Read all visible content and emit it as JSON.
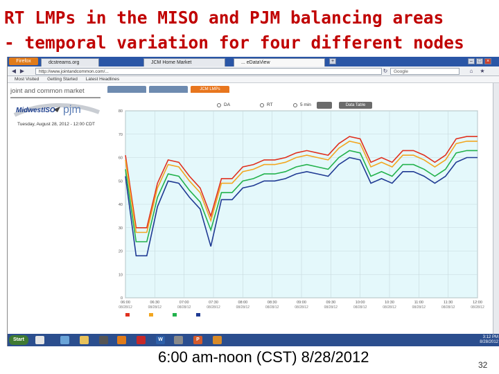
{
  "slide": {
    "title_line1": "RT LMPs in the MISO and PJM balancing areas",
    "title_line2": "- temporal variation for four different nodes",
    "caption": "6:00 am-noon (CST) 8/28/2012",
    "page_number": "32"
  },
  "browser": {
    "firefox_label": "Firefox",
    "tabs": [
      "dcstreams.org",
      "JCM Home Market",
      "... eDataView"
    ],
    "url": "http://www.jointandcommon.com/...",
    "search_placeholder": "Google",
    "bookmarks": [
      "Most Visited",
      "Getting Started",
      "Latest Headlines"
    ]
  },
  "site": {
    "header": "joint and common market",
    "miso_logo": "MidwestISO",
    "pjm_logo": "pjm",
    "date_line": "Tuesday, August 28, 2012 - 12:00 CDT",
    "tabs": [
      "",
      "",
      "JCM LMPs"
    ],
    "controls": [
      "DA",
      "RT",
      "5 min",
      "Data Table"
    ]
  },
  "taskbar": {
    "start_label": "Start",
    "clock_time": "3:12 PM",
    "clock_date": "8/28/2012"
  },
  "chart_data": {
    "type": "line",
    "x": [
      "06:00",
      "06:30",
      "07:00",
      "07:30",
      "08:00",
      "08:30",
      "09:00",
      "09:30",
      "10:00",
      "10:30",
      "11:00",
      "11:30",
      "12:00"
    ],
    "xdate": "08/28/12",
    "ylim": [
      0,
      80
    ],
    "yticks": [
      0,
      10,
      20,
      30,
      40,
      50,
      60,
      70,
      80
    ],
    "grid": true,
    "legend_placement": "bottom",
    "legend": [
      "",
      "",
      "",
      ""
    ],
    "series": [
      {
        "color": "#e0301e",
        "values": [
          61,
          30,
          30,
          49,
          59,
          58,
          52,
          47,
          35,
          51,
          51,
          56,
          57,
          59,
          59,
          60,
          62,
          63,
          62,
          61,
          66,
          69,
          68,
          58,
          60,
          58,
          63,
          63,
          61,
          58,
          61,
          68,
          69,
          69
        ]
      },
      {
        "color": "#f2a61f",
        "values": [
          59,
          28,
          28,
          47,
          57,
          56,
          50,
          45,
          33,
          49,
          49,
          54,
          55,
          57,
          57,
          58,
          60,
          61,
          60,
          59,
          64,
          67,
          66,
          56,
          58,
          56,
          61,
          61,
          59,
          56,
          59,
          66,
          67,
          67
        ]
      },
      {
        "color": "#22b24c",
        "values": [
          55,
          24,
          24,
          43,
          53,
          52,
          46,
          41,
          29,
          45,
          45,
          50,
          51,
          53,
          53,
          54,
          56,
          57,
          56,
          55,
          60,
          63,
          62,
          52,
          54,
          52,
          57,
          57,
          55,
          52,
          55,
          62,
          63,
          63
        ]
      },
      {
        "color": "#1f3a93",
        "values": [
          52,
          18,
          18,
          39,
          50,
          49,
          43,
          38,
          22,
          42,
          42,
          47,
          48,
          50,
          50,
          51,
          53,
          54,
          53,
          52,
          57,
          60,
          59,
          49,
          51,
          49,
          54,
          54,
          52,
          49,
          52,
          58,
          60,
          60
        ]
      }
    ]
  }
}
